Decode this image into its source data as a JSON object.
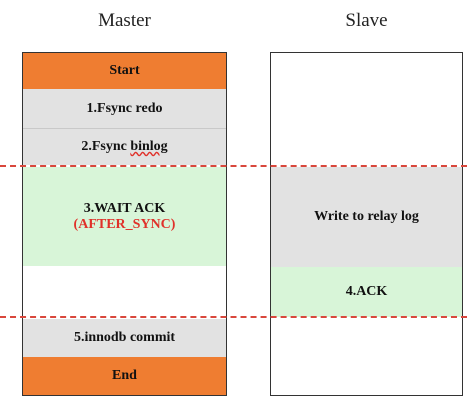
{
  "master": {
    "title": "Master",
    "start": "Start",
    "step1": "1.Fsync redo",
    "step2_prefix": "2.Fsync ",
    "step2_word": "binlog",
    "step3": "3.WAIT ACK",
    "step3_note": "(AFTER_SYNC)",
    "step5": "5.innodb commit",
    "end": "End"
  },
  "slave": {
    "title": "Slave",
    "relay": "Write to relay log",
    "ack": "4.ACK"
  },
  "colors": {
    "orange": "#ef7d31",
    "gray": "#e2e2e2",
    "green": "#d8f5d8",
    "red": "#d9473c"
  }
}
